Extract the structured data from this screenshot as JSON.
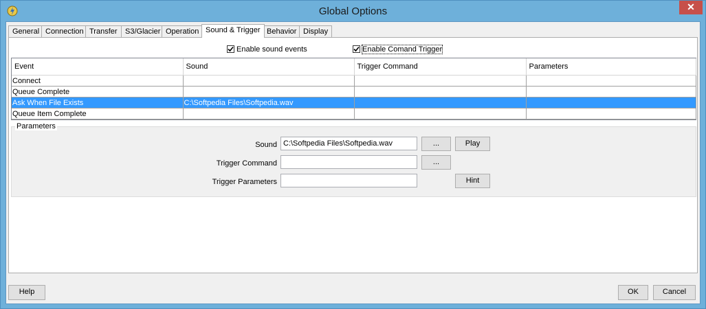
{
  "window": {
    "title": "Global Options",
    "close_glyph": "✕",
    "app_icon": "gear-lightning-icon"
  },
  "tabs": [
    {
      "label": "General",
      "active": false
    },
    {
      "label": "Connection",
      "active": false
    },
    {
      "label": "Transfer",
      "active": false
    },
    {
      "label": "S3/Glacier",
      "active": false
    },
    {
      "label": "Operation",
      "active": false
    },
    {
      "label": "Sound & Trigger",
      "active": true
    },
    {
      "label": "Behavior",
      "active": false
    },
    {
      "label": "Display",
      "active": false
    }
  ],
  "options": {
    "enable_sound": {
      "label": "Enable sound events",
      "checked": true
    },
    "enable_trigger": {
      "label": "Enable Comand Trigger",
      "checked": true
    }
  },
  "grid": {
    "columns": [
      "Event",
      "Sound",
      "Trigger Command",
      "Parameters"
    ],
    "rows": [
      {
        "event": "Connect",
        "sound": "",
        "trigger": "",
        "params": "",
        "selected": false
      },
      {
        "event": "Queue Complete",
        "sound": "",
        "trigger": "",
        "params": "",
        "selected": false
      },
      {
        "event": "Ask When File Exists",
        "sound": "C:\\Softpedia Files\\Softpedia.wav",
        "trigger": "",
        "params": "",
        "selected": true
      },
      {
        "event": "Queue Item Complete",
        "sound": "",
        "trigger": "",
        "params": "",
        "selected": false
      }
    ]
  },
  "parameters": {
    "group_label": "Parameters",
    "sound_label": "Sound",
    "sound_value": "C:\\Softpedia Files\\Softpedia.wav",
    "sound_browse": "...",
    "play_label": "Play",
    "trigger_label": "Trigger Command",
    "trigger_value": "",
    "trigger_browse": "...",
    "trigger_params_label": "Trigger Parameters",
    "trigger_params_value": "",
    "hint_label": "Hint"
  },
  "footer": {
    "help": "Help",
    "ok": "OK",
    "cancel": "Cancel"
  },
  "colors": {
    "selection": "#3399ff",
    "titlebar": "#6eb0da",
    "close": "#c7504a"
  }
}
